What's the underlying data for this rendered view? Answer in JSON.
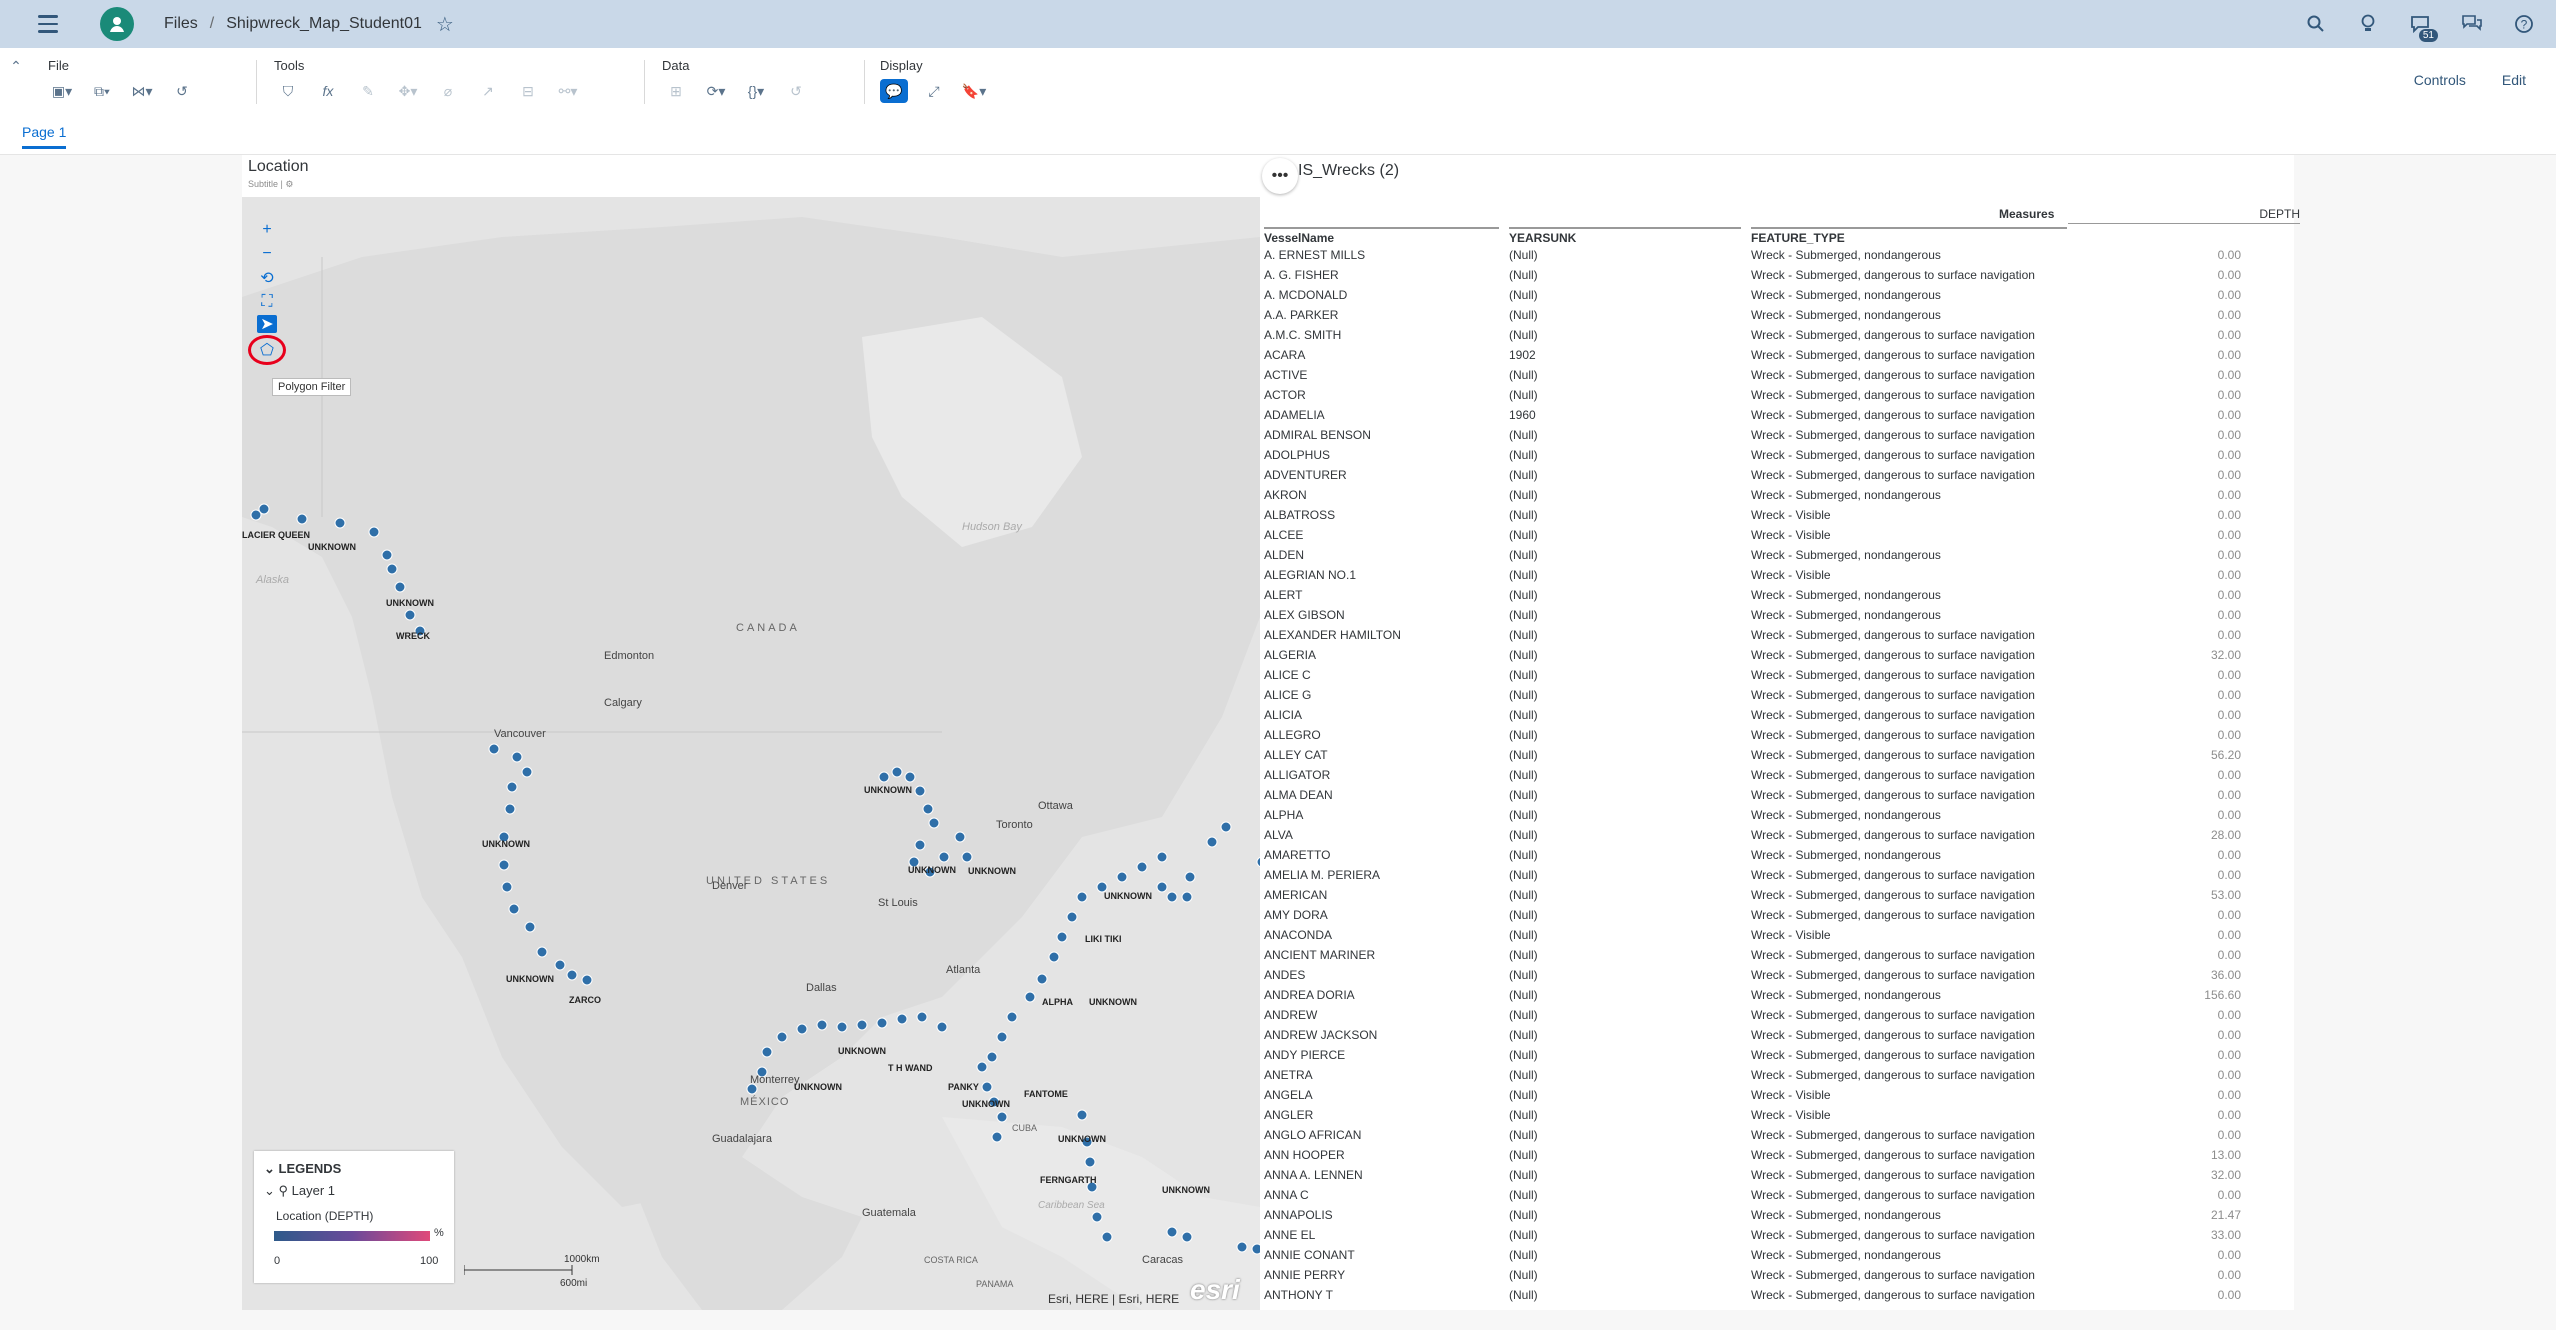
{
  "shell": {
    "files": "Files",
    "sep": "/",
    "doc_title": "Shipwreck_Map_Student01",
    "notif_count": "51"
  },
  "toolbar": {
    "file": "File",
    "tools": "Tools",
    "data": "Data",
    "display": "Display",
    "controls": "Controls",
    "edit": "Edit"
  },
  "page_tab": "Page 1",
  "map": {
    "title": "Location",
    "subtitle": "Subtitle",
    "tooltip": "Polygon Filter",
    "labels": {
      "hudson": "Hudson Bay",
      "canada": "CANADA",
      "edmonton": "Edmonton",
      "calgary": "Calgary",
      "vancouver": "Vancouver",
      "us": "UNITED STATES",
      "denver": "Denver",
      "stlouis": "St Louis",
      "ottawa": "Ottawa",
      "toronto": "Toronto",
      "dallas": "Dallas",
      "atlanta": "Atlanta",
      "monterrey": "Monterrey",
      "mexico": "MÉXICO",
      "guadalajara": "Guadalajara",
      "guatemala": "Guatemala",
      "caracas": "Caracas",
      "alaska": "Alaska",
      "costarica": "COSTA RICA",
      "panama": "PANAMA",
      "caribbean": "Caribbean Sea",
      "cuba": "CUBA"
    },
    "point_labels": {
      "unknown": "UNKNOWN",
      "glacier": "LACIER QUEEN",
      "wreck": "WRECK",
      "zarco": "ZARCO",
      "alpha": "ALPHA",
      "likitiki": "LIKI TIKI",
      "thwand": "T H WAND",
      "panky": "PANKY",
      "fantome": "FANTOME",
      "fernarth": "FERNGARTH"
    },
    "legend": {
      "header": "LEGENDS",
      "layer": "Layer 1",
      "measure": "Location (DEPTH)",
      "min": "0",
      "max": "100",
      "pct": "%"
    },
    "scale": {
      "km": "1000km",
      "mi": "600mi"
    },
    "attribution": "Esri, HERE | Esri, HERE",
    "esri_logo": "esri"
  },
  "table": {
    "title": "IS_Wrecks (2)",
    "measures": "Measures",
    "depth": "DEPTH",
    "columns": [
      "VesselName",
      "YEARSUNK",
      "FEATURE_TYPE"
    ],
    "rows": [
      [
        "A. ERNEST MILLS",
        "(Null)",
        "Wreck - Submerged, nondangerous",
        "0.00"
      ],
      [
        "A. G. FISHER",
        "(Null)",
        "Wreck - Submerged, dangerous to surface navigation",
        "0.00"
      ],
      [
        "A. MCDONALD",
        "(Null)",
        "Wreck - Submerged, nondangerous",
        "0.00"
      ],
      [
        "A.A. PARKER",
        "(Null)",
        "Wreck - Submerged, nondangerous",
        "0.00"
      ],
      [
        "A.M.C. SMITH",
        "(Null)",
        "Wreck - Submerged, dangerous to surface navigation",
        "0.00"
      ],
      [
        "ACARA",
        "1902",
        "Wreck - Submerged, dangerous to surface navigation",
        "0.00"
      ],
      [
        "ACTIVE",
        "(Null)",
        "Wreck - Submerged, dangerous to surface navigation",
        "0.00"
      ],
      [
        "ACTOR",
        "(Null)",
        "Wreck - Submerged, dangerous to surface navigation",
        "0.00"
      ],
      [
        "ADAMELIA",
        "1960",
        "Wreck - Submerged, dangerous to surface navigation",
        "0.00"
      ],
      [
        "ADMIRAL BENSON",
        "(Null)",
        "Wreck - Submerged, dangerous to surface navigation",
        "0.00"
      ],
      [
        "ADOLPHUS",
        "(Null)",
        "Wreck - Submerged, dangerous to surface navigation",
        "0.00"
      ],
      [
        "ADVENTURER",
        "(Null)",
        "Wreck - Submerged, dangerous to surface navigation",
        "0.00"
      ],
      [
        "AKRON",
        "(Null)",
        "Wreck - Submerged, nondangerous",
        "0.00"
      ],
      [
        "ALBATROSS",
        "(Null)",
        "Wreck - Visible",
        "0.00"
      ],
      [
        "ALCEE",
        "(Null)",
        "Wreck - Visible",
        "0.00"
      ],
      [
        "ALDEN",
        "(Null)",
        "Wreck - Submerged, nondangerous",
        "0.00"
      ],
      [
        "ALEGRIAN NO.1",
        "(Null)",
        "Wreck - Visible",
        "0.00"
      ],
      [
        "ALERT",
        "(Null)",
        "Wreck - Submerged, nondangerous",
        "0.00"
      ],
      [
        "ALEX GIBSON",
        "(Null)",
        "Wreck - Submerged, nondangerous",
        "0.00"
      ],
      [
        "ALEXANDER HAMILTON",
        "(Null)",
        "Wreck - Submerged, dangerous to surface navigation",
        "0.00"
      ],
      [
        "ALGERIA",
        "(Null)",
        "Wreck - Submerged, dangerous to surface navigation",
        "32.00"
      ],
      [
        "ALICE C",
        "(Null)",
        "Wreck - Submerged, dangerous to surface navigation",
        "0.00"
      ],
      [
        "ALICE G",
        "(Null)",
        "Wreck - Submerged, dangerous to surface navigation",
        "0.00"
      ],
      [
        "ALICIA",
        "(Null)",
        "Wreck - Submerged, dangerous to surface navigation",
        "0.00"
      ],
      [
        "ALLEGRO",
        "(Null)",
        "Wreck - Submerged, dangerous to surface navigation",
        "0.00"
      ],
      [
        "ALLEY CAT",
        "(Null)",
        "Wreck - Submerged, dangerous to surface navigation",
        "56.20"
      ],
      [
        "ALLIGATOR",
        "(Null)",
        "Wreck - Submerged, dangerous to surface navigation",
        "0.00"
      ],
      [
        "ALMA DEAN",
        "(Null)",
        "Wreck - Submerged, dangerous to surface navigation",
        "0.00"
      ],
      [
        "ALPHA",
        "(Null)",
        "Wreck - Submerged, nondangerous",
        "0.00"
      ],
      [
        "ALVA",
        "(Null)",
        "Wreck - Submerged, dangerous to surface navigation",
        "28.00"
      ],
      [
        "AMARETTO",
        "(Null)",
        "Wreck - Submerged, nondangerous",
        "0.00"
      ],
      [
        "AMELIA M. PERIERA",
        "(Null)",
        "Wreck - Submerged, dangerous to surface navigation",
        "0.00"
      ],
      [
        "AMERICAN",
        "(Null)",
        "Wreck - Submerged, dangerous to surface navigation",
        "53.00"
      ],
      [
        "AMY DORA",
        "(Null)",
        "Wreck - Submerged, dangerous to surface navigation",
        "0.00"
      ],
      [
        "ANACONDA",
        "(Null)",
        "Wreck - Visible",
        "0.00"
      ],
      [
        "ANCIENT MARINER",
        "(Null)",
        "Wreck - Submerged, dangerous to surface navigation",
        "0.00"
      ],
      [
        "ANDES",
        "(Null)",
        "Wreck - Submerged, dangerous to surface navigation",
        "36.00"
      ],
      [
        "ANDREA DORIA",
        "(Null)",
        "Wreck - Submerged, nondangerous",
        "156.60"
      ],
      [
        "ANDREW",
        "(Null)",
        "Wreck - Submerged, dangerous to surface navigation",
        "0.00"
      ],
      [
        "ANDREW JACKSON",
        "(Null)",
        "Wreck - Submerged, dangerous to surface navigation",
        "0.00"
      ],
      [
        "ANDY PIERCE",
        "(Null)",
        "Wreck - Submerged, dangerous to surface navigation",
        "0.00"
      ],
      [
        "ANETRA",
        "(Null)",
        "Wreck - Submerged, dangerous to surface navigation",
        "0.00"
      ],
      [
        "ANGELA",
        "(Null)",
        "Wreck - Visible",
        "0.00"
      ],
      [
        "ANGLER",
        "(Null)",
        "Wreck - Visible",
        "0.00"
      ],
      [
        "ANGLO AFRICAN",
        "(Null)",
        "Wreck - Submerged, dangerous to surface navigation",
        "0.00"
      ],
      [
        "ANN HOOPER",
        "(Null)",
        "Wreck - Submerged, dangerous to surface navigation",
        "13.00"
      ],
      [
        "ANNA A. LENNEN",
        "(Null)",
        "Wreck - Submerged, dangerous to surface navigation",
        "32.00"
      ],
      [
        "ANNA C",
        "(Null)",
        "Wreck - Submerged, dangerous to surface navigation",
        "0.00"
      ],
      [
        "ANNAPOLIS",
        "(Null)",
        "Wreck - Submerged, nondangerous",
        "21.47"
      ],
      [
        "ANNE EL",
        "(Null)",
        "Wreck - Submerged, dangerous to surface navigation",
        "33.00"
      ],
      [
        "ANNIE CONANT",
        "(Null)",
        "Wreck - Submerged, nondangerous",
        "0.00"
      ],
      [
        "ANNIE PERRY",
        "(Null)",
        "Wreck - Submerged, dangerous to surface navigation",
        "0.00"
      ],
      [
        "ANTHONY T",
        "(Null)",
        "Wreck - Submerged, dangerous to surface navigation",
        "0.00"
      ]
    ]
  }
}
